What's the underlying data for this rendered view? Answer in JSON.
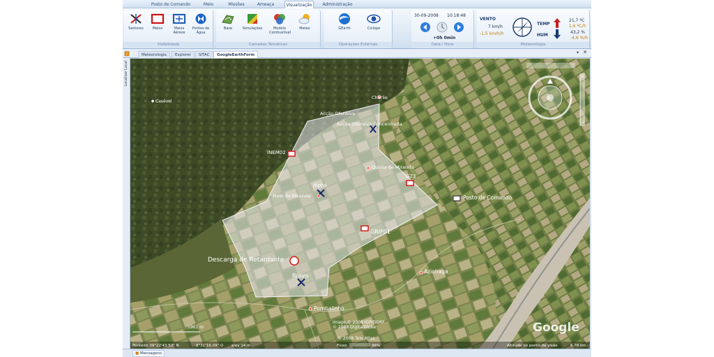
{
  "ribbon_tabs": [
    "Posto de Comando",
    "Meio",
    "Missões",
    "Ameaça",
    "Visualização",
    "Administração"
  ],
  "active_tab": "Visualização",
  "groups": {
    "visibilidade": {
      "label": "Visibilidade",
      "buttons": [
        "Sectores",
        "Meios",
        "Meios Aéreos",
        "Pontos de Água"
      ]
    },
    "camadas": {
      "label": "Camadas Temáticas",
      "buttons": [
        "Base",
        "Simulações",
        "Modelo Combustível",
        "Meteo"
      ]
    },
    "operacoes": {
      "label": "Operações Externas",
      "buttons": [
        "GEarth",
        "Ciclope"
      ]
    },
    "data_hora": {
      "label": "Data / Hora",
      "date": "30-09-2008",
      "time": "10:18:48",
      "offset": "+0h 0min"
    },
    "meteorologia": {
      "label": "Meteorologia",
      "vento_label": "VENTO",
      "vento_speed": "7 km/h",
      "vento_delta": "-1,5 km/h/h",
      "temp_label": "TEMP",
      "temp_value": "21,7 ºC",
      "temp_delta": "1,6 ºC/h",
      "hum_label": "HUM",
      "hum_value": "43,2 %",
      "hum_delta": "-4,6 %/h"
    }
  },
  "doc_tabs": [
    "Meteorologia",
    "Explorer",
    "SITAC",
    "GoogleEarthForm"
  ],
  "active_doc_tab": "GoogleEarthForm",
  "side_panel_label": "Localizar Local",
  "map": {
    "places": {
      "casevel": "Casével",
      "charlie": "Charlie",
      "accao_ofensiva": "Acção Ofensiva",
      "accao_concentrada": "Acção Ofensiva Concentrada",
      "inem": "INEM02",
      "quinta": "Quinta de Miranda",
      "alpha": "Alpha",
      "malo": "Malo de Miranda",
      "g23": "G23",
      "posto": "Posto de Comando",
      "grif": "GRIF01",
      "descarga": "Descarga de Retardante",
      "bravo": "Bravo",
      "azinhaga": "Azinhaga",
      "pombalinho": "Pombalinho"
    },
    "scale": "1961 m",
    "copyright1": "Image © 2008 IGP/DGRF",
    "copyright2": "© 2008 DigitalGlobe",
    "copyright3": "© 2008 Tele Atlas",
    "google_logo": "Google",
    "pointer": "Ponteiro 39°22'43.53\" N",
    "pointer_lon": "8°31'16.09\" O",
    "elev": "elev 14 m",
    "fluxo": "Fluxo",
    "fluxo_value": "96%",
    "altitude": "Altitude do ponto de visão",
    "altitude_value": "6.78 km"
  },
  "status_tab": "Mensagens"
}
